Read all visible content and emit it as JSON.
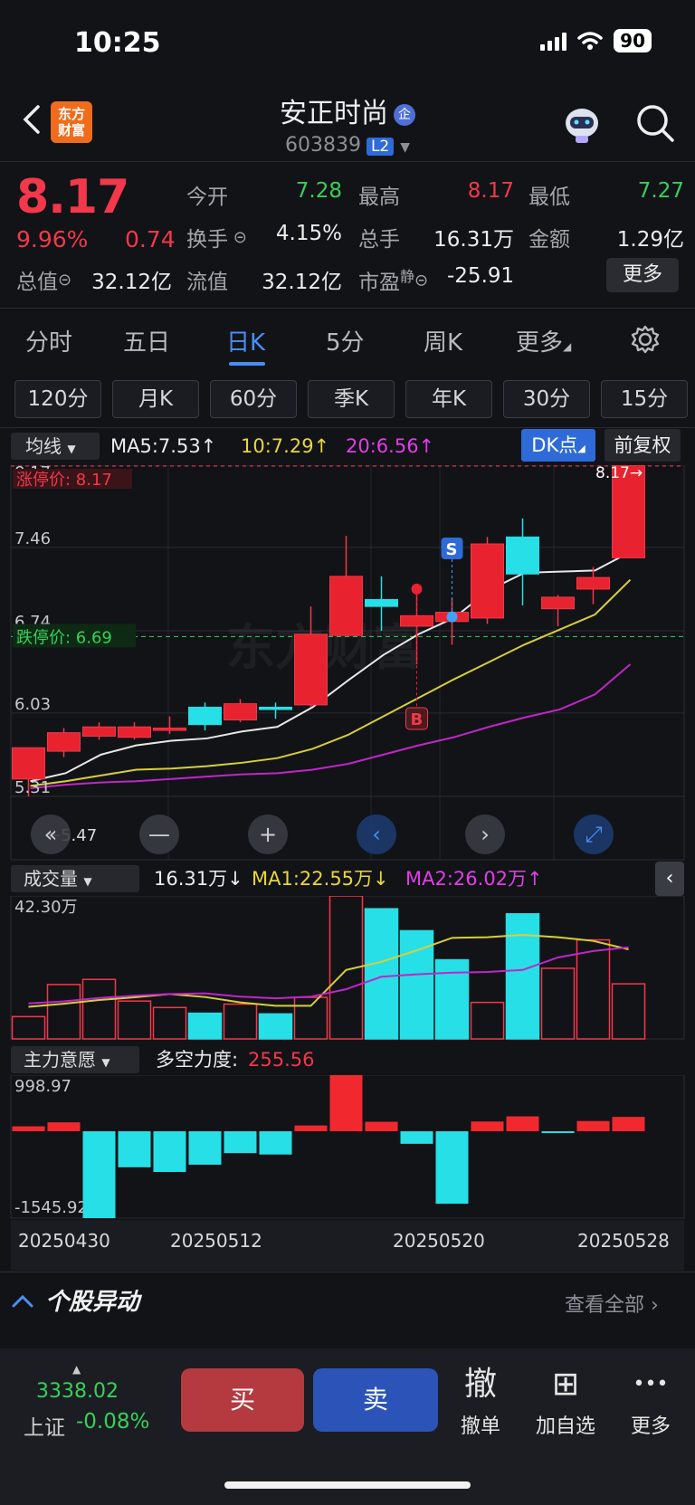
{
  "status": {
    "time": "10:25",
    "battery": "90"
  },
  "header": {
    "logo_text": "东方\n财富",
    "name": "安正时尚",
    "name_badge": "企",
    "code": "603839",
    "level": "L2"
  },
  "quote": {
    "price": "8.17",
    "pct": "9.96%",
    "change": "0.74",
    "rows": [
      [
        {
          "label": "今开",
          "value": "7.28",
          "color": "green"
        },
        {
          "label": "最高",
          "value": "8.17",
          "color": "red"
        },
        {
          "label": "最低",
          "value": "7.27",
          "color": "green"
        }
      ],
      [
        {
          "label": "换手",
          "value": "4.15%",
          "color": "white"
        },
        {
          "label": "总手",
          "value": "16.31万",
          "color": "white"
        },
        {
          "label": "金额",
          "value": "1.29亿",
          "color": "white"
        }
      ],
      [
        {
          "label": "总值",
          "value": "32.12亿",
          "color": "white"
        },
        {
          "label": "流值",
          "value": "32.12亿",
          "color": "white"
        },
        {
          "label": "市盈",
          "value": "-25.91",
          "color": "white"
        }
      ]
    ],
    "pe_superscript": "静",
    "more_label": "更多"
  },
  "tabs": [
    "分时",
    "五日",
    "日K",
    "5分",
    "周K",
    "更多"
  ],
  "active_tab": "日K",
  "periods": [
    "120分",
    "月K",
    "60分",
    "季K",
    "年K",
    "30分",
    "15分"
  ],
  "ma_bar": {
    "dropdown": "均线",
    "ma5": "MA5:7.53↑",
    "ma10": "10:7.29↑",
    "ma20": "20:6.56↑",
    "dk": "DK点",
    "fq": "前复权"
  },
  "colors": {
    "up": "#f2384a",
    "down": "#27dfe6",
    "ma5": "#e8e8e8",
    "ma10": "#d7cf3a",
    "ma20": "#c026c9",
    "accent": "#2f6bd8"
  },
  "chart_data": [
    {
      "type": "candlestick",
      "axis_labels": [
        "8.17",
        "7.46",
        "6.74",
        "6.03",
        "5.31"
      ],
      "ylim": [
        5.31,
        8.17
      ],
      "limit_up_label": "涨停价: 8.17",
      "limit_down_label": "跌停价: 6.69",
      "limit_up": 8.17,
      "limit_down": 6.69,
      "last_price_tag": "8.17→",
      "low_tag": "←5.47",
      "markers": {
        "buy": "B",
        "sell": "S"
      },
      "candles": [
        {
          "o": 5.46,
          "h": 5.54,
          "l": 5.31,
          "c": 5.73
        },
        {
          "o": 5.7,
          "h": 5.9,
          "l": 5.65,
          "c": 5.86
        },
        {
          "o": 5.83,
          "h": 5.95,
          "l": 5.8,
          "c": 5.91
        },
        {
          "o": 5.82,
          "h": 5.95,
          "l": 5.8,
          "c": 5.91
        },
        {
          "o": 5.88,
          "h": 6.0,
          "l": 5.85,
          "c": 5.9
        },
        {
          "o": 6.08,
          "h": 6.12,
          "l": 5.88,
          "c": 5.93
        },
        {
          "o": 5.97,
          "h": 6.15,
          "l": 5.95,
          "c": 6.11
        },
        {
          "o": 6.08,
          "h": 6.12,
          "l": 5.98,
          "c": 6.06
        },
        {
          "o": 6.1,
          "h": 6.95,
          "l": 6.08,
          "c": 6.71
        },
        {
          "o": 6.7,
          "h": 7.56,
          "l": 6.7,
          "c": 7.21
        },
        {
          "o": 7.01,
          "h": 7.21,
          "l": 6.74,
          "c": 6.95
        },
        {
          "o": 6.78,
          "h": 7.14,
          "l": 6.45,
          "c": 6.87
        },
        {
          "o": 6.82,
          "h": 7.02,
          "l": 6.62,
          "c": 6.9
        },
        {
          "o": 6.85,
          "h": 7.55,
          "l": 6.8,
          "c": 7.49
        },
        {
          "o": 7.55,
          "h": 7.71,
          "l": 6.96,
          "c": 7.23
        },
        {
          "o": 6.93,
          "h": 7.05,
          "l": 6.78,
          "c": 7.03
        },
        {
          "o": 7.1,
          "h": 7.29,
          "l": 6.97,
          "c": 7.2
        },
        {
          "o": 7.37,
          "h": 8.17,
          "l": 7.37,
          "c": 8.17
        }
      ],
      "ma5": [
        5.55,
        5.62,
        5.78,
        5.86,
        5.9,
        5.92,
        5.98,
        6.02,
        6.19,
        6.42,
        6.64,
        6.82,
        6.96,
        7.2,
        7.35,
        7.36,
        7.37,
        7.53
      ],
      "ma10": [
        5.51,
        5.55,
        5.6,
        5.65,
        5.66,
        5.68,
        5.71,
        5.75,
        5.83,
        5.95,
        6.11,
        6.27,
        6.43,
        6.58,
        6.73,
        6.86,
        6.99,
        7.29
      ],
      "ma20": [
        5.49,
        5.52,
        5.54,
        5.55,
        5.57,
        5.59,
        5.61,
        5.62,
        5.65,
        5.7,
        5.78,
        5.86,
        5.93,
        6.02,
        6.1,
        6.17,
        6.3,
        6.56
      ]
    },
    {
      "type": "bar",
      "dropdown": "成交量",
      "vol_label": "16.31万↓",
      "ma1_label": "MA1:22.55万↓",
      "ma2_label": "MA2:26.02万↑",
      "axis_label": "42.30万",
      "ylim": [
        0,
        42.3
      ],
      "values": [
        6.6,
        16.1,
        17.6,
        11.2,
        9.3,
        7.6,
        10.3,
        7.4,
        12.3,
        42.3,
        38.5,
        32.0,
        23.4,
        10.8,
        37.0,
        20.9,
        29.3,
        16.3
      ],
      "ma1": [
        9.5,
        10.4,
        11.5,
        12.3,
        13.3,
        12.4,
        10.8,
        9.8,
        9.8,
        20.4,
        22.8,
        26.2,
        29.9,
        30.1,
        30.8,
        30.1,
        29.0,
        26.5
      ],
      "ma2": [
        10.5,
        11.1,
        12.1,
        12.8,
        13.3,
        13.5,
        12.5,
        12.0,
        12.5,
        14.7,
        18.4,
        19.1,
        19.6,
        19.8,
        20.4,
        24.1,
        26.0,
        27.1
      ],
      "up": [
        true,
        true,
        true,
        true,
        true,
        false,
        true,
        false,
        true,
        true,
        false,
        false,
        false,
        true,
        false,
        true,
        true,
        true
      ]
    },
    {
      "type": "bar",
      "dropdown": "主力意愿",
      "label": "多空力度:",
      "value": "255.56",
      "axis_labels": [
        "998.97",
        "-1545.92"
      ],
      "ylim": [
        -1545.92,
        998.97
      ],
      "values": [
        88,
        159,
        -1545.92,
        -641,
        -725,
        -595,
        -389,
        -414,
        103,
        998.97,
        169,
        -223,
        -1290,
        173,
        265,
        -15,
        182,
        255.56
      ],
      "dates": [
        "20250430",
        "20250512",
        "20250520",
        "20250528"
      ]
    }
  ],
  "yidong": {
    "title": "个股异动",
    "more": "查看全部"
  },
  "tabbar": {
    "index_value": "3338.02",
    "index_name": "上证",
    "index_pct": "-0.08%",
    "buy": "买",
    "sell": "卖",
    "items": [
      {
        "icon": "撤",
        "label": "撤单"
      },
      {
        "icon": "⊞",
        "label": "加自选"
      },
      {
        "icon": "•••",
        "label": "更多"
      }
    ]
  }
}
